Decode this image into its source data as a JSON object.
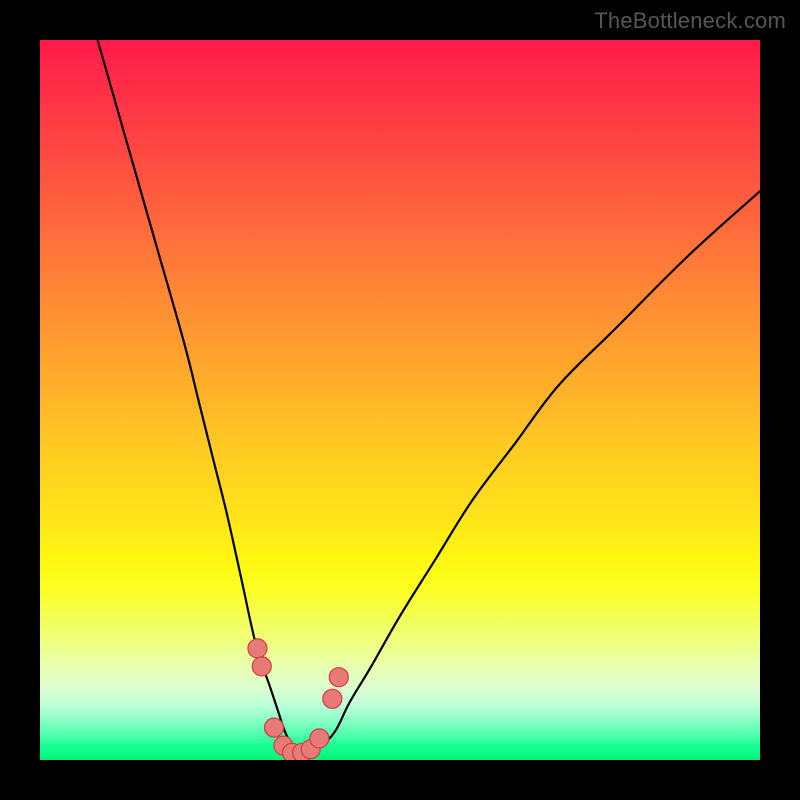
{
  "watermark": "TheBottleneck.com",
  "colors": {
    "frame": "#000000",
    "curve": "#000000",
    "marker_fill": "#e97a78",
    "marker_stroke": "#c9403c",
    "gradient_top": "#ff1a4b",
    "gradient_bottom": "#00f57a"
  },
  "chart_data": {
    "type": "line",
    "title": "",
    "xlabel": "",
    "ylabel": "",
    "xlim": [
      0,
      100
    ],
    "ylim": [
      0,
      100
    ],
    "grid": false,
    "legend": false,
    "note": "Background vertical gradient (red→orange→yellow→green) encodes percent bottleneck; curve shows bottleneck% vs an unlabeled x-axis; salmon markers highlight near-minimum points.",
    "series": [
      {
        "name": "bottleneck-curve",
        "x": [
          8,
          12,
          16,
          20,
          22,
          24,
          26,
          28,
          30,
          32,
          33,
          34,
          35,
          36,
          37,
          39,
          41,
          43,
          46,
          50,
          55,
          60,
          66,
          72,
          80,
          90,
          100
        ],
        "y": [
          100,
          86,
          72,
          58,
          50,
          42,
          34,
          25,
          16,
          10,
          7,
          4,
          2,
          1,
          1,
          2,
          4,
          8,
          13,
          20,
          28,
          36,
          44,
          52,
          60,
          70,
          79
        ]
      }
    ],
    "markers": {
      "name": "near-optimum-points",
      "x": [
        30.2,
        30.8,
        32.5,
        33.8,
        35.0,
        36.4,
        37.6,
        38.8,
        40.6,
        41.5
      ],
      "y": [
        15.5,
        13.0,
        4.5,
        2.0,
        1.0,
        1.0,
        1.5,
        3.0,
        8.5,
        11.5
      ]
    }
  }
}
